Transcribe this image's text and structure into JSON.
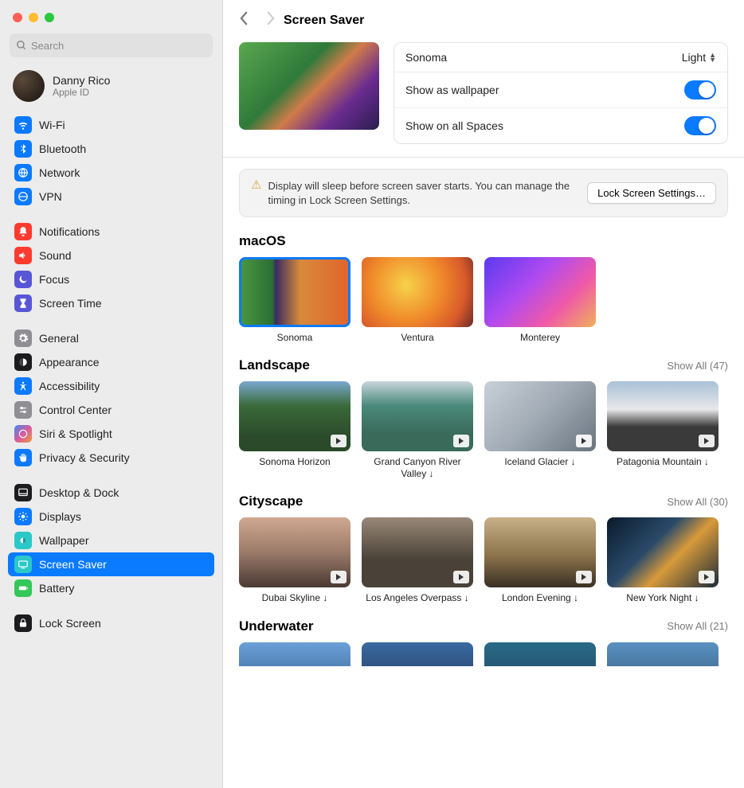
{
  "search_placeholder": "Search",
  "account": {
    "name": "Danny Rico",
    "sub": "Apple ID"
  },
  "sidebar": [
    {
      "group": [
        {
          "label": "Wi-Fi",
          "color": "#0b7aff",
          "icon": "wifi"
        },
        {
          "label": "Bluetooth",
          "color": "#0b7aff",
          "icon": "bt"
        },
        {
          "label": "Network",
          "color": "#0b7aff",
          "icon": "net"
        },
        {
          "label": "VPN",
          "color": "#0b7aff",
          "icon": "vpn"
        }
      ]
    },
    {
      "group": [
        {
          "label": "Notifications",
          "color": "#ff3b30",
          "icon": "bell"
        },
        {
          "label": "Sound",
          "color": "#ff3b30",
          "icon": "snd"
        },
        {
          "label": "Focus",
          "color": "#5856d6",
          "icon": "moon"
        },
        {
          "label": "Screen Time",
          "color": "#5856d6",
          "icon": "hg"
        }
      ]
    },
    {
      "group": [
        {
          "label": "General",
          "color": "#8e8e93",
          "icon": "gear"
        },
        {
          "label": "Appearance",
          "color": "#1c1c1e",
          "icon": "app"
        },
        {
          "label": "Accessibility",
          "color": "#0b7aff",
          "icon": "acc"
        },
        {
          "label": "Control Center",
          "color": "#8e8e93",
          "icon": "cc"
        },
        {
          "label": "Siri & Spotlight",
          "color": "linear-gradient(135deg,#3a8af0,#d85aa0,#f09a3a)",
          "icon": "siri"
        },
        {
          "label": "Privacy & Security",
          "color": "#0b7aff",
          "icon": "hand"
        }
      ]
    },
    {
      "group": [
        {
          "label": "Desktop & Dock",
          "color": "#1c1c1e",
          "icon": "dock"
        },
        {
          "label": "Displays",
          "color": "#0b7aff",
          "icon": "disp"
        },
        {
          "label": "Wallpaper",
          "color": "#2ac8c8",
          "icon": "wp"
        },
        {
          "label": "Screen Saver",
          "color": "#2ac8c8",
          "icon": "ss",
          "selected": true
        },
        {
          "label": "Battery",
          "color": "#34c759",
          "icon": "bat"
        }
      ]
    },
    {
      "group": [
        {
          "label": "Lock Screen",
          "color": "#1c1c1e",
          "icon": "lock"
        }
      ]
    }
  ],
  "title": "Screen Saver",
  "current": {
    "name": "Sonoma",
    "mode": "Light"
  },
  "opts": {
    "wallpaper_label": "Show as wallpaper",
    "spaces_label": "Show on all Spaces"
  },
  "warning": {
    "text": "Display will sleep before screen saver starts. You can manage the timing in Lock Screen Settings.",
    "button": "Lock Screen Settings…"
  },
  "sections": [
    {
      "name": "macOS",
      "items": [
        {
          "label": "Sonoma",
          "g": "g-sonoma",
          "selected": true
        },
        {
          "label": "Ventura",
          "g": "g-ventura"
        },
        {
          "label": "Monterey",
          "g": "g-monterey"
        }
      ]
    },
    {
      "name": "Landscape",
      "showall": "Show All (47)",
      "video": true,
      "peek": true,
      "items": [
        {
          "label": "Sonoma Horizon",
          "g": "g-sonomah"
        },
        {
          "label": "Grand Canyon River Valley ↓",
          "g": "g-canyon"
        },
        {
          "label": "Iceland Glacier ↓",
          "g": "g-iceland"
        },
        {
          "label": "Patagonia Mountain ↓",
          "g": "g-patagonia"
        }
      ]
    },
    {
      "name": "Cityscape",
      "showall": "Show All (30)",
      "video": true,
      "peek": true,
      "items": [
        {
          "label": "Dubai Skyline ↓",
          "g": "g-dubai"
        },
        {
          "label": "Los Angeles Overpass ↓",
          "g": "g-la"
        },
        {
          "label": "London Evening ↓",
          "g": "g-london"
        },
        {
          "label": "New York Night ↓",
          "g": "g-nyc"
        }
      ]
    },
    {
      "name": "Underwater",
      "showall": "Show All (21)",
      "video": true,
      "peek": true,
      "cut": true,
      "items": [
        {
          "label": "",
          "g": "g-uw1"
        },
        {
          "label": "",
          "g": "g-uw2"
        },
        {
          "label": "",
          "g": "g-uw3"
        },
        {
          "label": "",
          "g": "g-uw4"
        }
      ]
    }
  ]
}
